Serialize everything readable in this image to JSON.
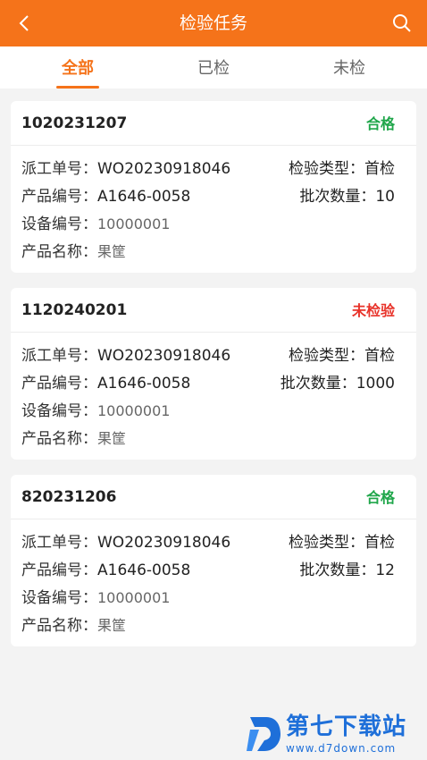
{
  "header": {
    "title": "检验任务",
    "back_icon": "chevron-left-icon",
    "search_icon": "search-icon"
  },
  "tabs": [
    {
      "label": "全部",
      "active": true
    },
    {
      "label": "已检",
      "active": false
    },
    {
      "label": "未检",
      "active": false
    }
  ],
  "labels": {
    "order": "派工单号：",
    "product_no": "产品编号：",
    "device_no": "设备编号：",
    "product_name": "产品名称：",
    "inspect_type": "检验类型：",
    "batch_qty": "批次数量："
  },
  "cards": [
    {
      "id": "1020231207",
      "status": "合格",
      "order": "WO20230918046",
      "product_no": "A1646-0058",
      "device_no": "10000001",
      "product_name": "果筐",
      "inspect_type": "首检",
      "batch_qty": "10"
    },
    {
      "id": "1120240201",
      "status": "未检验",
      "order": "WO20230918046",
      "product_no": "A1646-0058",
      "device_no": "10000001",
      "product_name": "果筐",
      "inspect_type": "首检",
      "batch_qty": "1000"
    },
    {
      "id": "820231206",
      "status": "合格",
      "order": "WO20230918046",
      "product_no": "A1646-0058",
      "device_no": "10000001",
      "product_name": "果筐",
      "inspect_type": "首检",
      "batch_qty": "12"
    }
  ],
  "colors": {
    "accent": "#f5731a",
    "pass": "#1fa64a",
    "pending": "#e8332a"
  },
  "watermark": {
    "text": "第七下载站",
    "url": "www.d7down.com"
  }
}
